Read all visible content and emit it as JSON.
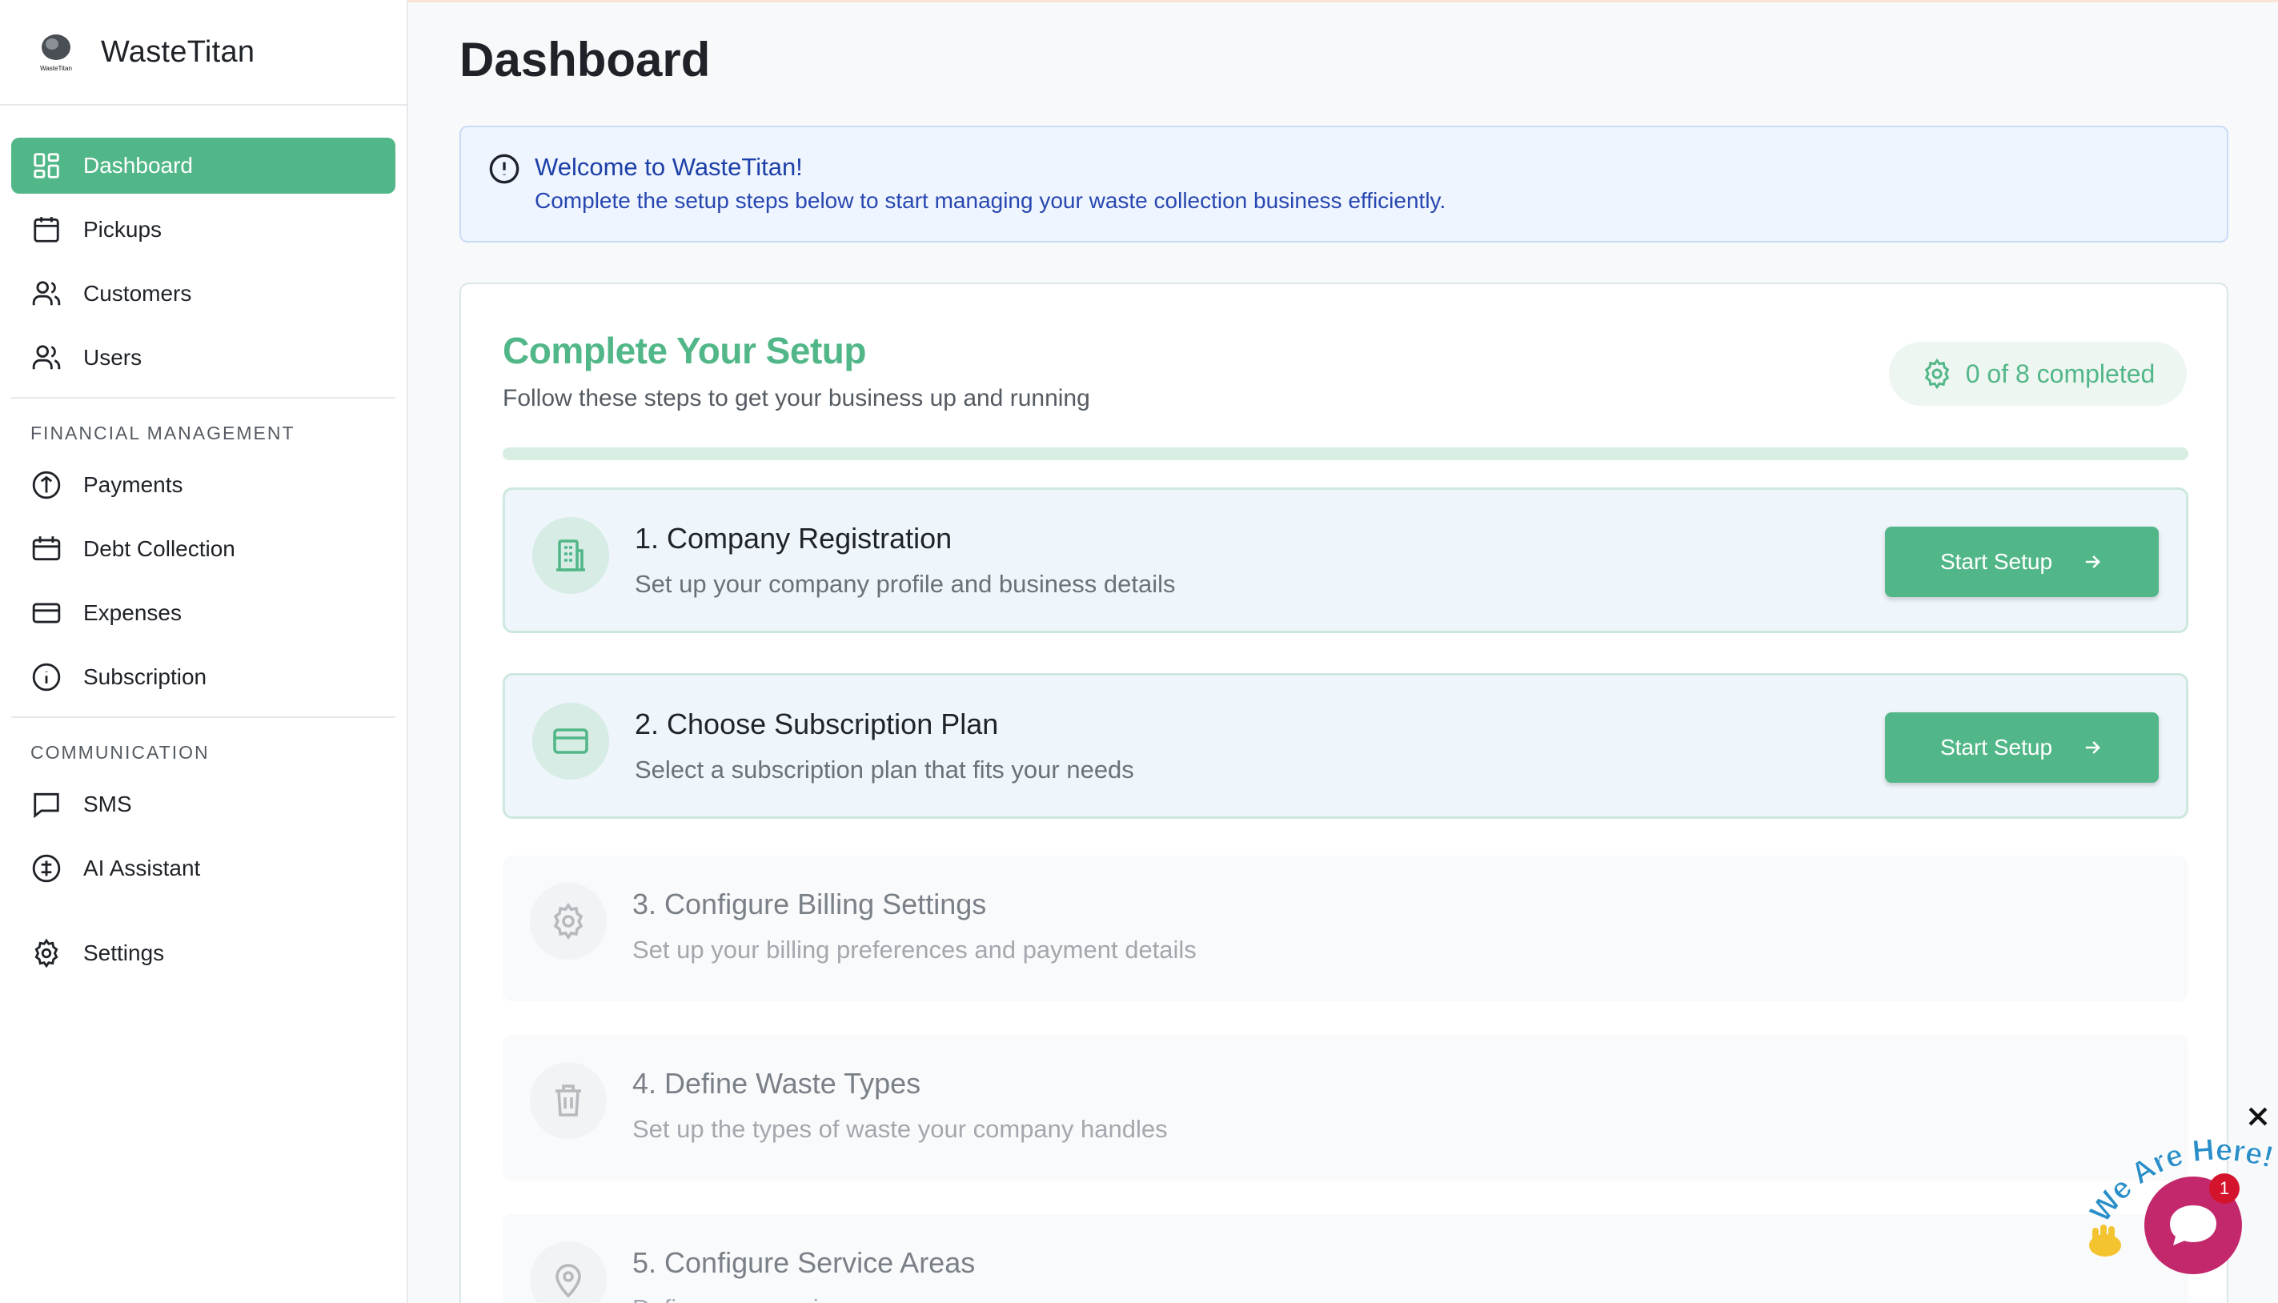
{
  "app": {
    "name": "WasteTitan",
    "logo_text": "WasteTitan"
  },
  "sidebar": {
    "items": [
      {
        "label": "Dashboard",
        "icon": "dashboard-grid-icon",
        "active": true
      },
      {
        "label": "Pickups",
        "icon": "calendar-icon"
      },
      {
        "label": "Customers",
        "icon": "users-icon"
      },
      {
        "label": "Users",
        "icon": "users-icon"
      }
    ],
    "financial": {
      "heading": "FINANCIAL MANAGEMENT",
      "items": [
        {
          "label": "Payments",
          "icon": "payment-circle-icon"
        },
        {
          "label": "Debt Collection",
          "icon": "calendar-icon"
        },
        {
          "label": "Expenses",
          "icon": "credit-card-icon"
        },
        {
          "label": "Subscription",
          "icon": "info-circle-icon"
        }
      ]
    },
    "communication": {
      "heading": "COMMUNICATION",
      "items": [
        {
          "label": "SMS",
          "icon": "message-icon"
        },
        {
          "label": "AI Assistant",
          "icon": "ai-circle-icon"
        }
      ]
    },
    "settings": {
      "label": "Settings",
      "icon": "gear-icon"
    }
  },
  "main": {
    "title": "Dashboard",
    "alert": {
      "title": "Welcome to WasteTitan!",
      "description": "Complete the setup steps below to start managing your waste collection business efficiently."
    },
    "setup": {
      "title": "Complete Your Setup",
      "subtitle": "Follow these steps to get your business up and running",
      "badge": "0 of 8 completed",
      "progress": 0,
      "button_label": "Start Setup",
      "steps": [
        {
          "title": "1. Company Registration",
          "description": "Set up your company profile and business details",
          "icon": "building-icon",
          "state": "available"
        },
        {
          "title": "2. Choose Subscription Plan",
          "description": "Select a subscription plan that fits your needs",
          "icon": "credit-card-icon",
          "state": "available"
        },
        {
          "title": "3. Configure Billing Settings",
          "description": "Set up your billing preferences and payment details",
          "icon": "gear-icon",
          "state": "locked"
        },
        {
          "title": "4. Define Waste Types",
          "description": "Set up the types of waste your company handles",
          "icon": "trash-icon",
          "state": "locked"
        },
        {
          "title": "5. Configure Service Areas",
          "description": "Define your service areas",
          "icon": "map-pin-icon",
          "state": "locked"
        }
      ]
    }
  },
  "chat": {
    "tagline": "We Are Here!",
    "unread_count": "1"
  },
  "colors": {
    "accent": "#52b788",
    "alert_bg": "#eef5ff",
    "alert_text": "#1d3fa8",
    "chat": "#c2286b"
  }
}
